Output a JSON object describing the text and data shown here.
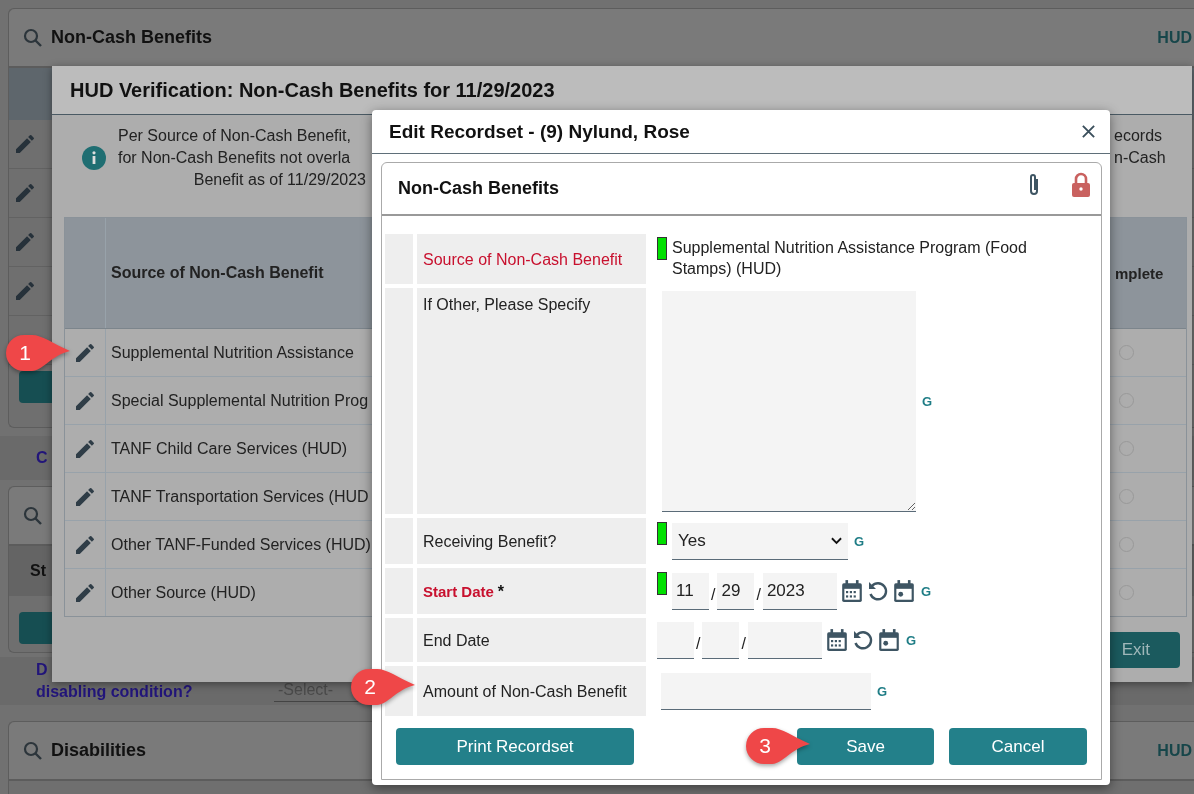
{
  "page": {
    "benefits_panel": {
      "title": "Non-Cash Benefits",
      "tag": "HUD"
    },
    "cut_label": "C",
    "second_panel": {
      "header_cut": "St"
    },
    "disabling_question": {
      "line_1": "D",
      "line_2": "disabling condition?",
      "select_placeholder": "-Select-"
    },
    "disabilities_panel": {
      "title": "Disabilities",
      "tag": "HUD"
    }
  },
  "verification_dialog": {
    "title": "HUD Verification: Non-Cash Benefits for 11/29/2023",
    "info_left": [
      "Per Source of Non-Cash Benefit,",
      "for Non-Cash Benefits not overla",
      "Benefit as of 11/29/2023"
    ],
    "info_right": [
      "ecords",
      "n-Cash"
    ],
    "columns": [
      "Source of Non-Cash Benefit",
      "mplete"
    ],
    "rows": [
      {
        "source": "Supplemental Nutrition Assistance",
        "complete": false
      },
      {
        "source": "Special Supplemental Nutrition Prog",
        "complete": false
      },
      {
        "source": "TANF Child Care Services (HUD)",
        "complete": false
      },
      {
        "source": "TANF Transportation Services (HUD",
        "complete": false
      },
      {
        "source": "Other TANF-Funded Services (HUD)",
        "complete": false
      },
      {
        "source": "Other Source (HUD)",
        "complete": false
      }
    ],
    "exit_button": "Exit"
  },
  "edit_dialog": {
    "title": "Edit Recordset - (9) Nylund, Rose",
    "section_title": "Non-Cash Benefits",
    "fields": [
      {
        "kind": "text",
        "label": "Source of Non-Cash Benefit",
        "flagged": true,
        "required": false,
        "indicator": true,
        "value": "Supplemental Nutrition Assistance Program (Food Stamps) (HUD)"
      },
      {
        "kind": "textarea",
        "label": "If Other, Please Specify",
        "flagged": false,
        "required": false,
        "indicator": false,
        "g_link": "G"
      },
      {
        "kind": "select",
        "label": "Receiving Benefit?",
        "flagged": false,
        "required": false,
        "indicator": true,
        "value": "Yes",
        "g_link": "G"
      },
      {
        "kind": "date",
        "label": "Start Date",
        "flagged": true,
        "required": true,
        "required_mark": "*",
        "indicator": true,
        "month": "11",
        "day": "29",
        "year": "2023",
        "separators": [
          "/",
          "/"
        ],
        "g_link": "G"
      },
      {
        "kind": "date",
        "label": "End Date",
        "flagged": false,
        "required": false,
        "indicator": false,
        "separators": [
          "/",
          "/"
        ],
        "g_link": "G"
      },
      {
        "kind": "input",
        "label": "Amount of Non-Cash Benefit",
        "flagged": false,
        "required": false,
        "indicator": false,
        "g_link": "G"
      }
    ],
    "buttons": [
      {
        "kind": "print",
        "label": "Print Recordset"
      },
      {
        "kind": "save",
        "label": "Save"
      },
      {
        "kind": "cancel",
        "label": "Cancel"
      }
    ]
  },
  "callouts": [
    {
      "label": "1"
    },
    {
      "label": "2"
    },
    {
      "label": "3"
    }
  ]
}
